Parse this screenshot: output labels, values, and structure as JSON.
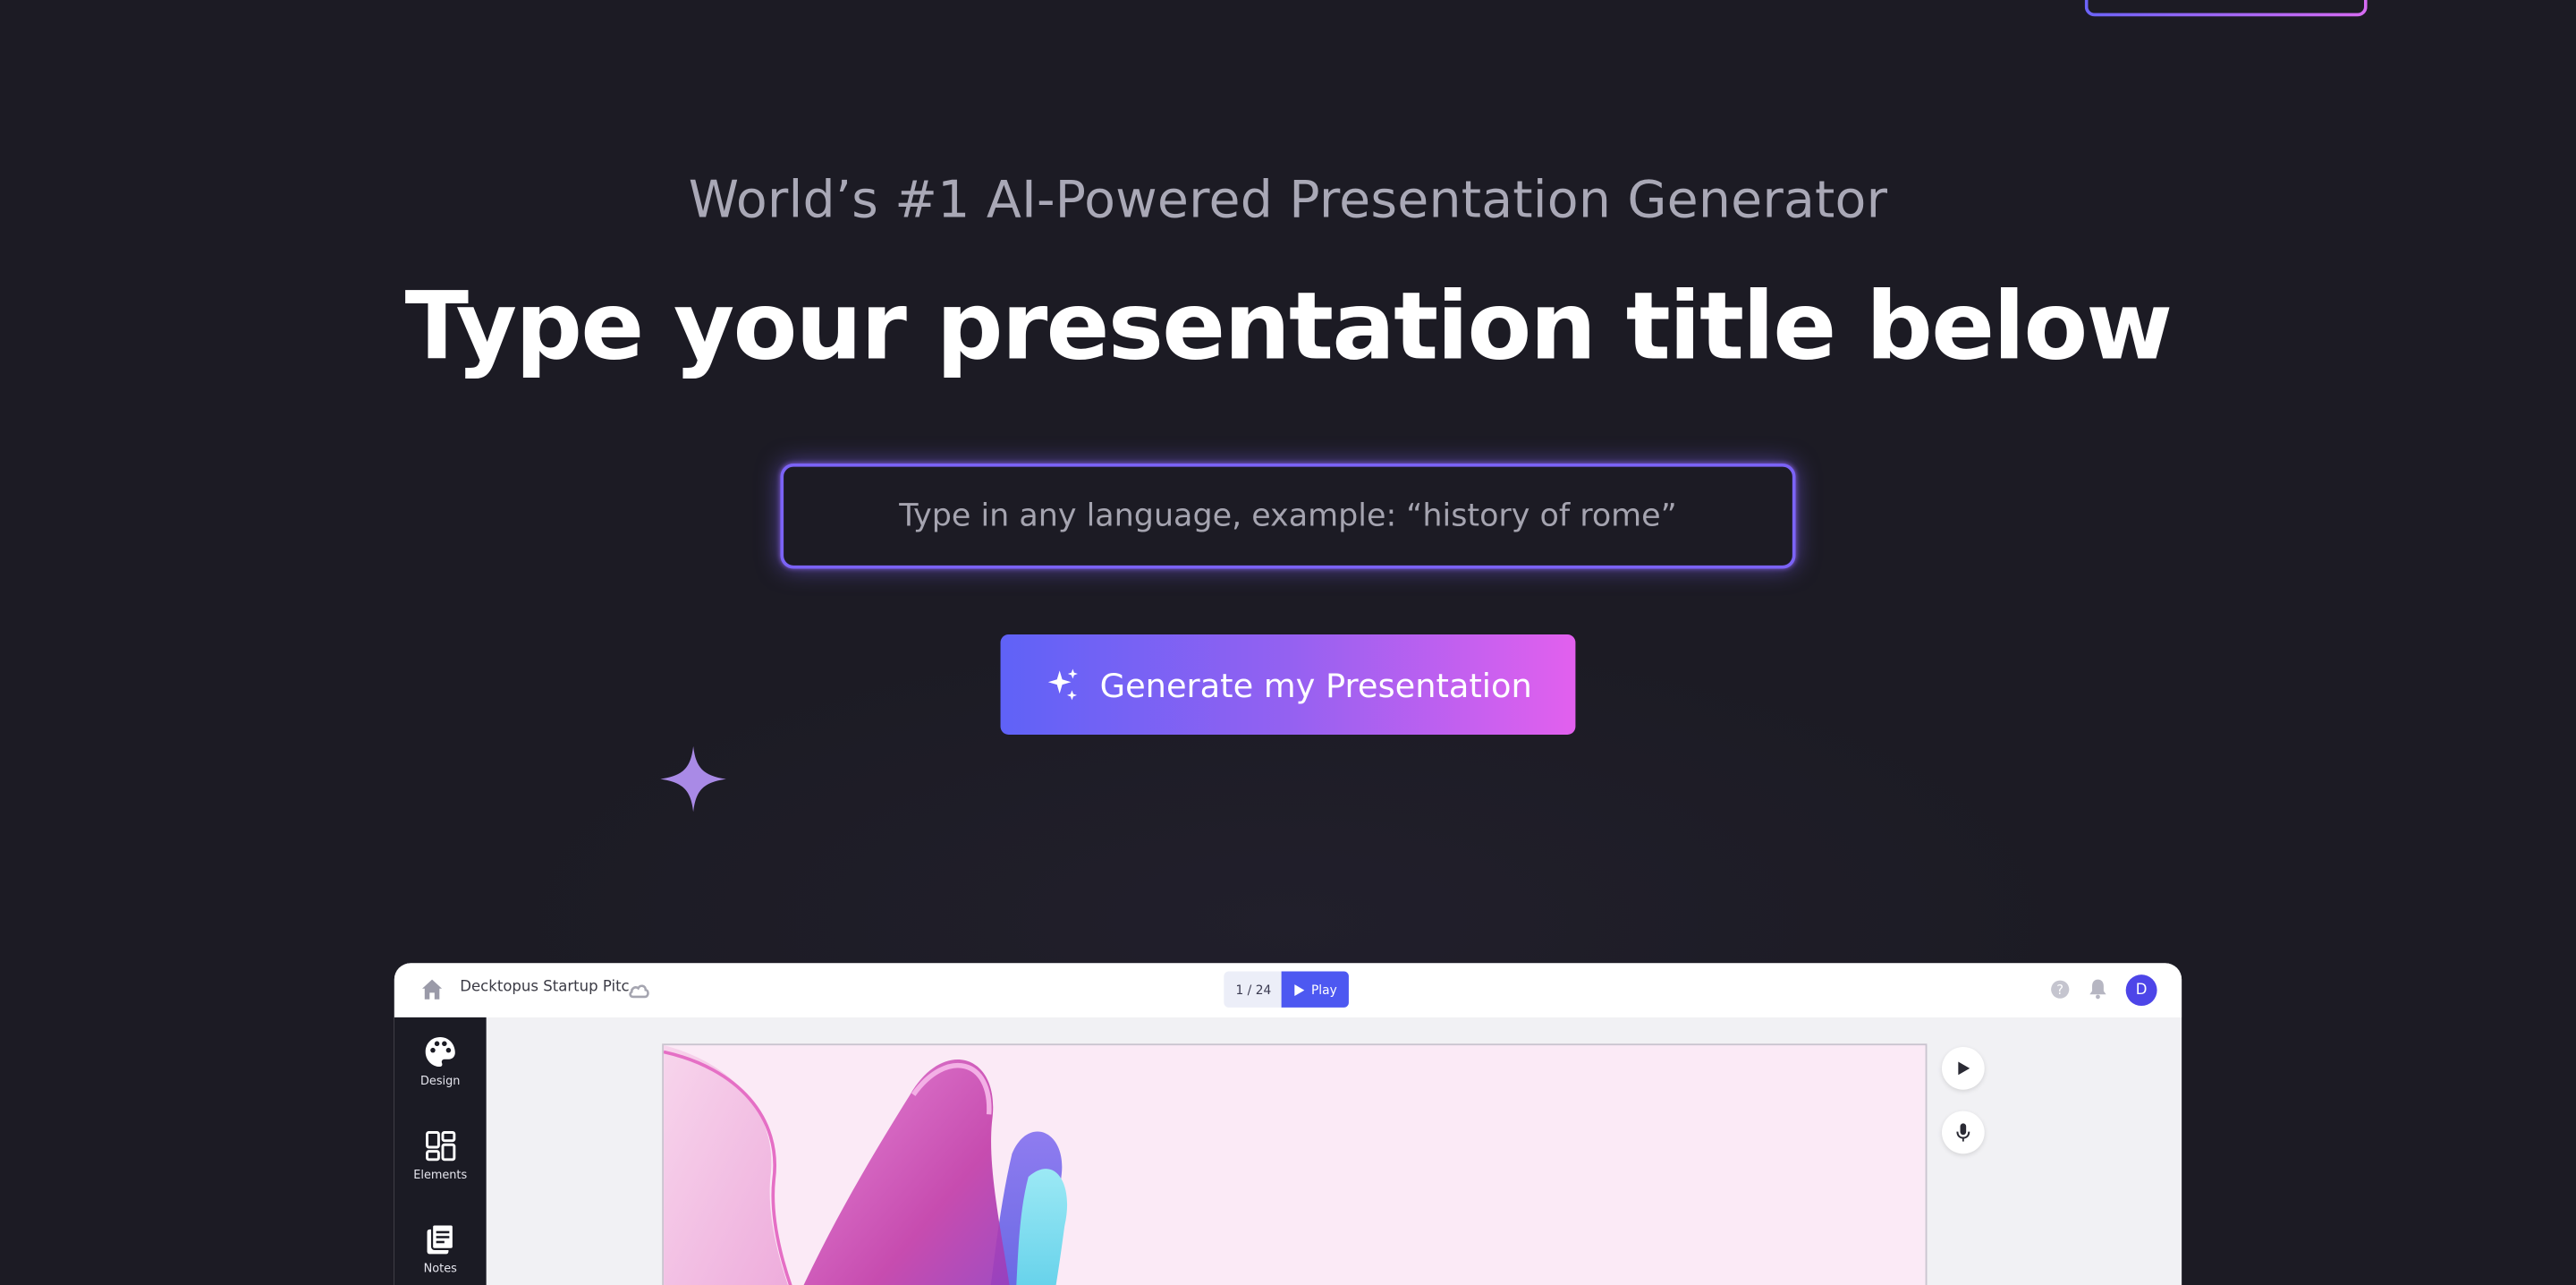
{
  "hero": {
    "tagline": "World’s #1 AI-Powered Presentation Generator",
    "headline": "Type your presentation title below",
    "input_placeholder": "Type in any language, example: “history of rome”",
    "input_value": "",
    "generate_label": "Generate my Presentation"
  },
  "preview": {
    "doc_title": "Decktopus Startup Pitc.",
    "page_counter": "1 / 24",
    "play_label": "Play",
    "avatar_initial": "D",
    "sidebar": [
      {
        "icon": "palette-icon",
        "label": "Design"
      },
      {
        "icon": "elements-icon",
        "label": "Elements"
      },
      {
        "icon": "notes-icon",
        "label": "Notes"
      }
    ]
  },
  "colors": {
    "background": "#1c1b24",
    "accent_start": "#5f62f7",
    "accent_end": "#e260ee",
    "input_border": "#7b63f6",
    "sparkle": "#a98ae6"
  }
}
